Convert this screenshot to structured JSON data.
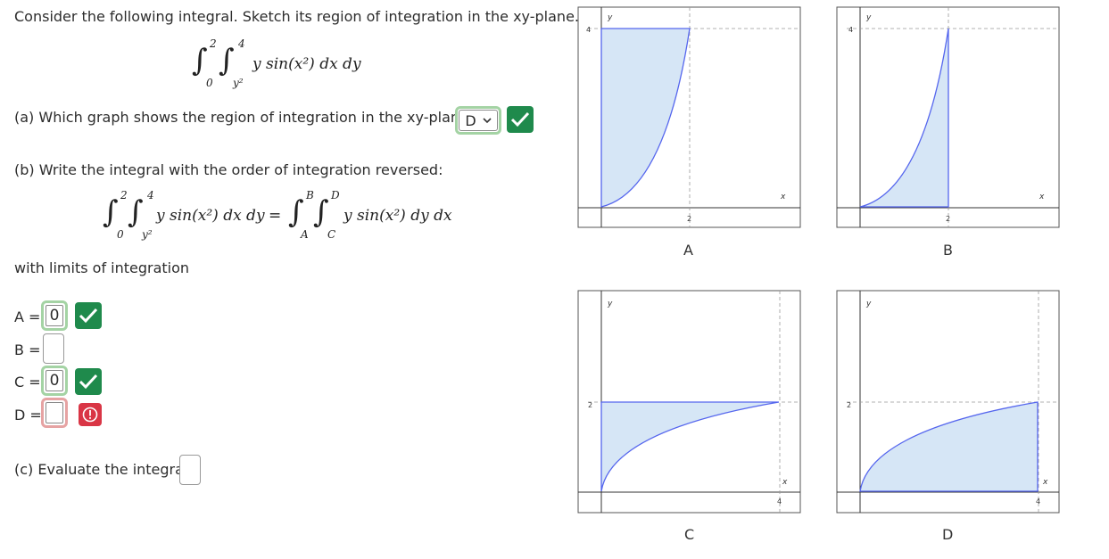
{
  "question": {
    "intro": "Consider the following integral. Sketch its region of integration in the xy-plane.",
    "integral": {
      "outer_lower": "0",
      "outer_upper": "2",
      "inner_lower": "y²",
      "inner_upper": "4",
      "integrand": "y sin(x²) dx dy"
    },
    "part_a": {
      "label": "(a) Which graph shows the region of integration in the xy-plane?",
      "selected": "D",
      "status": "correct"
    },
    "part_b": {
      "label": "(b) Write the integral with the order of integration reversed:",
      "lhs": {
        "outer_lower": "0",
        "outer_upper": "2",
        "inner_lower": "y²",
        "inner_upper": "4",
        "integrand": "y sin(x²) dx dy"
      },
      "equals": "=",
      "rhs": {
        "outer_lower": "A",
        "outer_upper": "B",
        "inner_lower": "C",
        "inner_upper": "D",
        "integrand": "y sin(x²) dy dx"
      },
      "limits_label": "with limits of integration",
      "fields": [
        {
          "name": "A",
          "label": "A =",
          "value": "0",
          "status": "correct"
        },
        {
          "name": "B",
          "label": "B =",
          "value": "",
          "status": "none"
        },
        {
          "name": "C",
          "label": "C =",
          "value": "0",
          "status": "correct"
        },
        {
          "name": "D",
          "label": "D =",
          "value": "",
          "status": "incorrect"
        }
      ]
    },
    "part_c": {
      "label": "(c) Evaluate the integral.",
      "value": ""
    }
  },
  "graphs": [
    {
      "id": "A",
      "caption": "A",
      "y_axis": "y",
      "x_axis": "x",
      "y_tick": "4",
      "x_tick": "2"
    },
    {
      "id": "B",
      "caption": "B",
      "y_axis": "y",
      "x_axis": "x",
      "y_tick": "4",
      "x_tick": "2"
    },
    {
      "id": "C",
      "caption": "C",
      "y_axis": "y",
      "x_axis": "x",
      "y_tick": "2",
      "x_tick": "4"
    },
    {
      "id": "D",
      "caption": "D",
      "y_axis": "y",
      "x_axis": "x",
      "y_tick": "2",
      "x_tick": "4"
    }
  ],
  "colors": {
    "correct": "#1f8a4c",
    "incorrect": "#d93545",
    "region_fill": "#d6e6f6",
    "region_stroke": "#5566ee"
  }
}
